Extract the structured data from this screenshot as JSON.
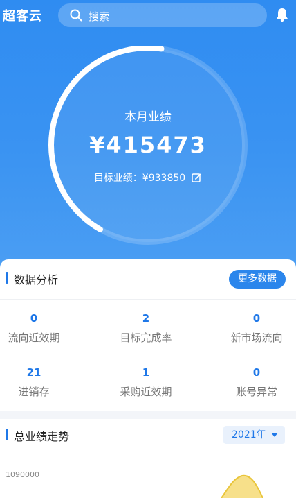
{
  "header": {
    "app_title": "超客云",
    "search_placeholder": "搜索"
  },
  "summary": {
    "label": "本月业绩",
    "value": "¥415473",
    "target_label": "目标业绩：¥933850",
    "progress": 0.44
  },
  "analysis": {
    "title": "数据分析",
    "more_label": "更多数据",
    "stats": [
      {
        "value": "0",
        "label": "流向近效期"
      },
      {
        "value": "2",
        "label": "目标完成率"
      },
      {
        "value": "0",
        "label": "新市场流向"
      },
      {
        "value": "21",
        "label": "进销存"
      },
      {
        "value": "1",
        "label": "采购近效期"
      },
      {
        "value": "0",
        "label": "账号异常"
      }
    ]
  },
  "trend": {
    "title": "总业绩走势",
    "year": "2021年",
    "y_tick": "1090000"
  },
  "colors": {
    "accent": "#1f78e8",
    "hero": "#3a93f2",
    "chart_fill": "#f7e08a",
    "chart_line": "#e9c53a"
  }
}
